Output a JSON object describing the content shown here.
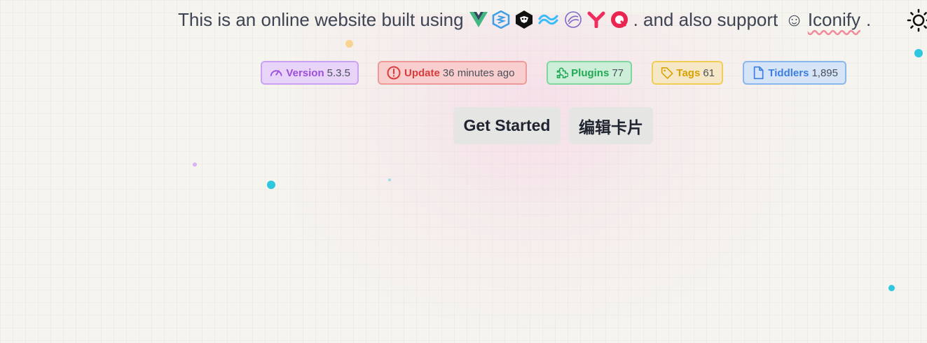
{
  "headline": {
    "prefix": "This is an online website built using",
    "middle": ". and also support",
    "link_text": "Iconify",
    "suffix": ".",
    "icons": [
      "vue-icon",
      "vite-icon",
      "tiddlywiki-icon",
      "tailwind-icon",
      "wasm-icon",
      "yarn-icon",
      "quasar-icon"
    ],
    "smile_icon": "smile-icon"
  },
  "theme_toggle": {
    "icon": "sun-icon"
  },
  "badges": {
    "version": {
      "label": "Version",
      "value": "5.3.5",
      "icon": "gauge-icon",
      "color": "#9d4fdb"
    },
    "update": {
      "label": "Update",
      "value": "36 minutes ago",
      "icon": "alert-circle-icon",
      "color": "#dc3b3b"
    },
    "plugins": {
      "label": "Plugins",
      "value": "77",
      "icon": "puzzle-icon",
      "color": "#21a955"
    },
    "tags": {
      "label": "Tags",
      "value": "61",
      "icon": "tag-icon",
      "color": "#d8a100"
    },
    "tiddlers": {
      "label": "Tiddlers",
      "value": "1,895",
      "icon": "file-icon",
      "color": "#3a7fe1"
    }
  },
  "actions": {
    "get_started": "Get Started",
    "edit_card": "编辑卡片"
  }
}
